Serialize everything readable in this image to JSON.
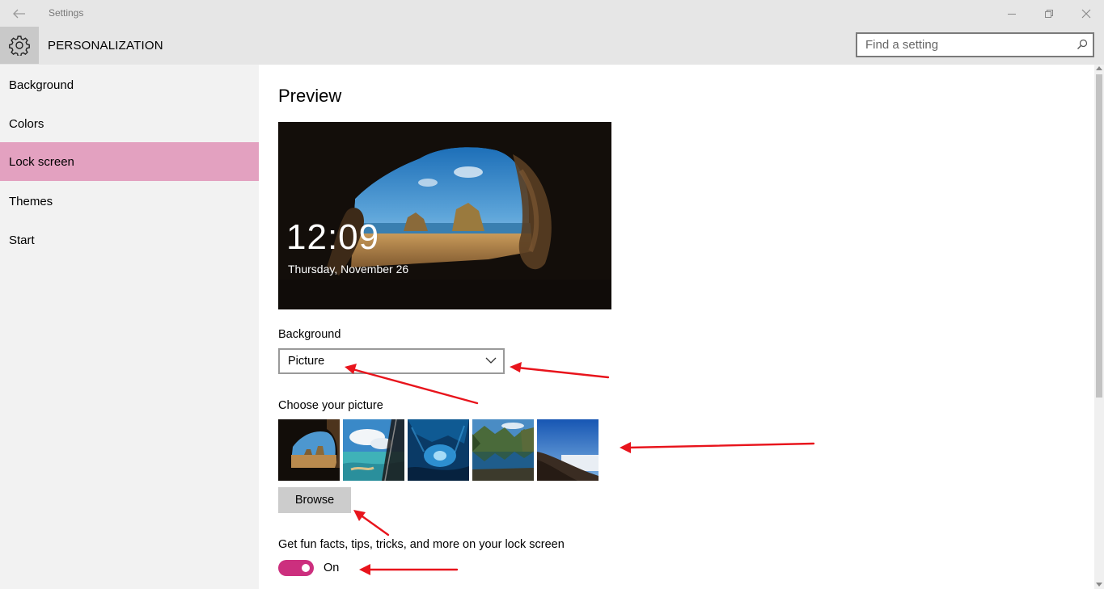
{
  "window": {
    "app_title": "Settings",
    "controls": {
      "minimize_icon": "minimize-icon",
      "restore_icon": "restore-icon",
      "close_icon": "close-icon"
    }
  },
  "header": {
    "section_title": "PERSONALIZATION",
    "search_placeholder": "Find a setting",
    "search_value": ""
  },
  "sidebar": {
    "items": [
      {
        "label": "Background",
        "active": false
      },
      {
        "label": "Colors",
        "active": false
      },
      {
        "label": "Lock screen",
        "active": true
      },
      {
        "label": "Themes",
        "active": false
      },
      {
        "label": "Start",
        "active": false
      }
    ]
  },
  "main": {
    "preview_title": "Preview",
    "preview": {
      "time": "12:09",
      "date": "Thursday, November 26"
    },
    "background_label": "Background",
    "background_selected": "Picture",
    "choose_label": "Choose your picture",
    "thumbnails": [
      {
        "name": "cave-beach-picture"
      },
      {
        "name": "aerial-coast-picture"
      },
      {
        "name": "ice-cave-picture"
      },
      {
        "name": "mountain-lake-picture"
      },
      {
        "name": "hillside-sky-picture"
      }
    ],
    "browse_label": "Browse",
    "fun_facts_label": "Get fun facts, tips, tricks, and more on your lock screen",
    "fun_facts_state": "On",
    "fun_facts_on": true
  },
  "colors": {
    "accent": "#cc2f7e",
    "sidebar_active": "#e3a1c0",
    "annotation": "#e8141c"
  }
}
